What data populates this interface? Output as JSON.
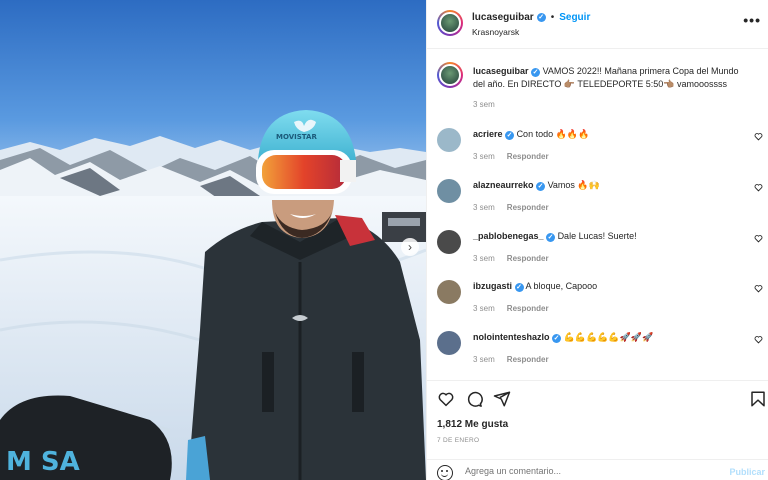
{
  "post": {
    "username": "lucaseguibar",
    "follow_label": "Seguir",
    "dot": "•",
    "location": "Krasnoyarsk",
    "more": "•••"
  },
  "caption": {
    "username": "lucaseguibar",
    "text": "VAMOS 2022!! Mañana primera Copa del Mundo del año. En DIRECTO 👉🏽 TELEDEPORTE 5:50👈🏽 vamooossss",
    "time": "3 sem"
  },
  "comments": [
    {
      "username": "acriere",
      "text": "Con todo 🔥🔥🔥",
      "time": "3 sem",
      "reply": "Responder",
      "avatar_color": "#9bb8c9"
    },
    {
      "username": "alazneaurreko",
      "text": "Vamos 🔥🙌",
      "time": "3 sem",
      "reply": "Responder",
      "avatar_color": "#6f8fa3"
    },
    {
      "username": "_pablobenegas_",
      "text": "Dale Lucas! Suerte!",
      "time": "3 sem",
      "reply": "Responder",
      "avatar_color": "#4a4a4a"
    },
    {
      "username": "ibzugasti",
      "text": "A bloque, Capooo",
      "time": "3 sem",
      "reply": "Responder",
      "avatar_color": "#8a7a62"
    },
    {
      "username": "nolointenteshazlo",
      "text": "💪💪💪💪💪🚀🚀🚀",
      "time": "3 sem",
      "reply": "Responder",
      "avatar_color": "#5b6f8c"
    }
  ],
  "icons": {
    "like": "heart-icon",
    "comment": "comment-icon",
    "share": "share-icon",
    "save": "bookmark-icon",
    "next": "chevron-right-icon",
    "emoji": "emoji-icon"
  },
  "stats": {
    "likes": "1,812 Me gusta",
    "date": "7 DE ENERO"
  },
  "comment_box": {
    "placeholder": "Agrega un comentario...",
    "publish_label": "Publicar"
  },
  "photo": {
    "helmet_text": "MOVISTAR",
    "board_text": "M  SA",
    "next_glyph": "›"
  },
  "colors": {
    "accent": "#0095f6",
    "verified": "#3897f0",
    "muted": "#8e8e8e",
    "sky_top": "#2f6fc4",
    "helmet": "#4fc3e0",
    "goggles": "#e5512a",
    "jacket": "#2a3238"
  }
}
